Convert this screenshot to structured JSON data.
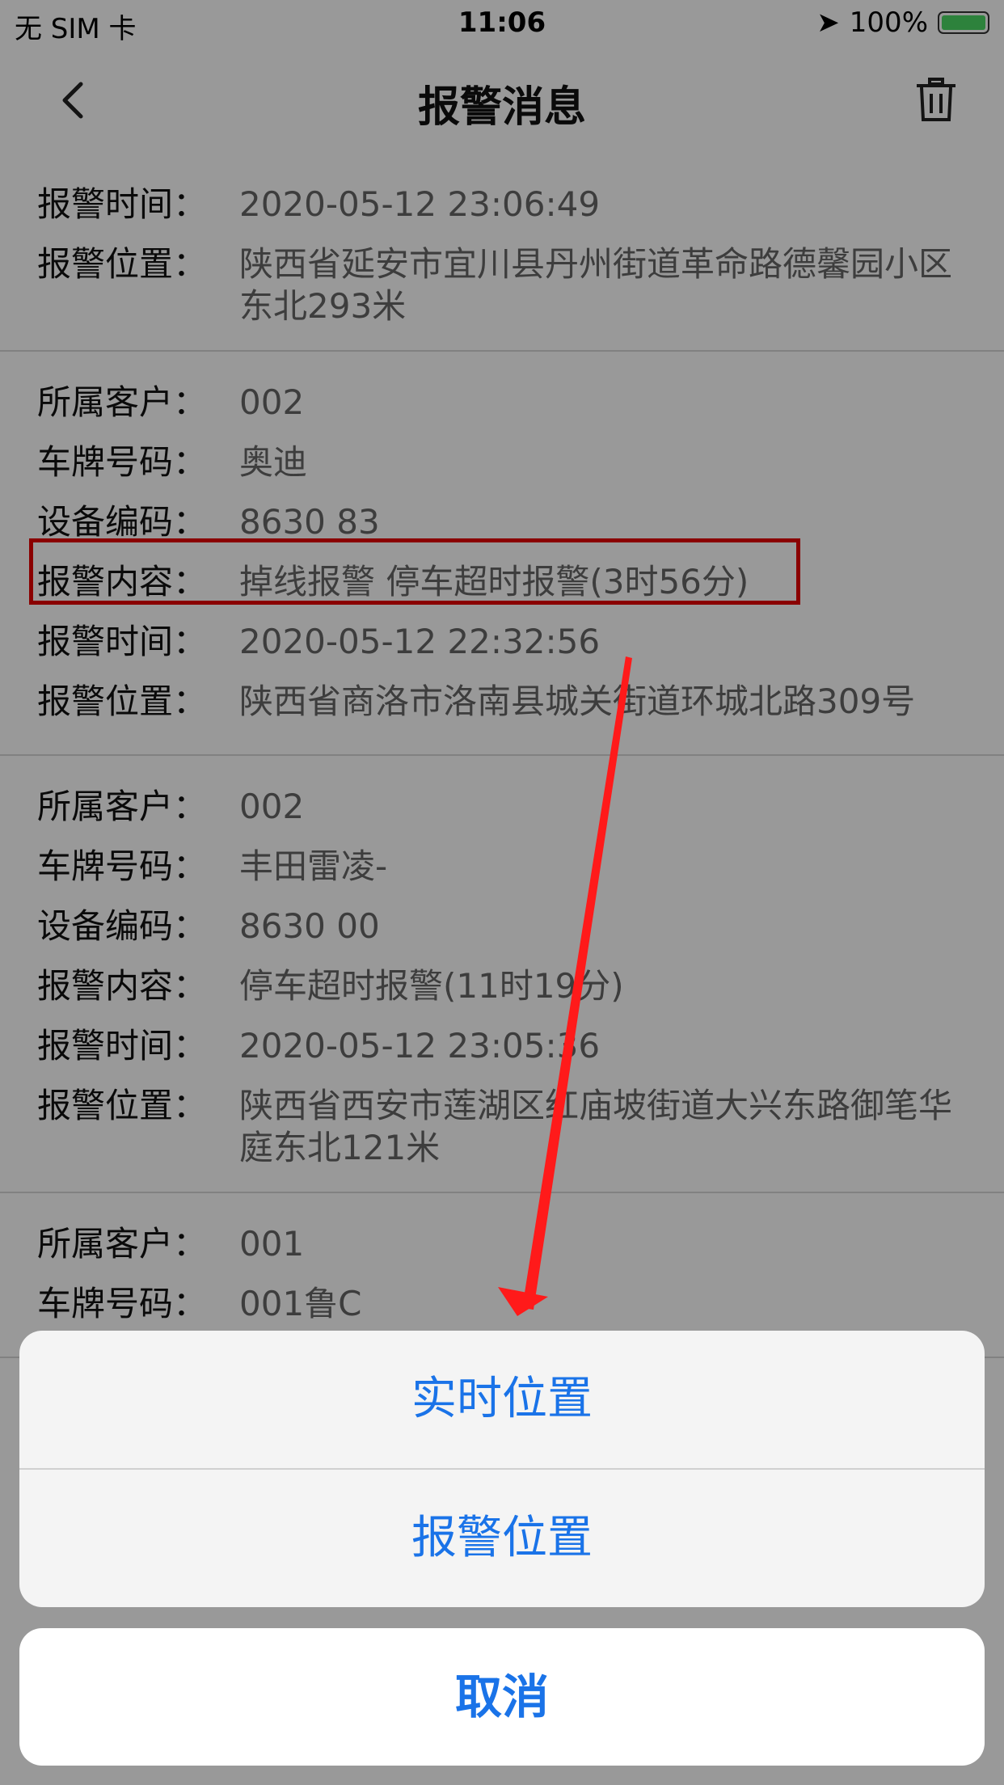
{
  "status_bar": {
    "carrier": "无 SIM 卡",
    "time": "11:06",
    "battery": "100%"
  },
  "header": {
    "title": "报警消息"
  },
  "records": [
    {
      "rows": [
        {
          "label": "报警时间：",
          "value": "2020-05-12 23:06:49"
        },
        {
          "label": "报警位置：",
          "value": "陕西省延安市宜川县丹州街道革命路德馨园小区东北293米"
        }
      ]
    },
    {
      "rows": [
        {
          "label": "所属客户：",
          "value": "002"
        },
        {
          "label": "车牌号码：",
          "value": "奥迪"
        },
        {
          "label": "设备编码：",
          "value": "8630 83"
        },
        {
          "label": "报警内容：",
          "value": " 掉线报警 停车超时报警(3时56分)"
        },
        {
          "label": "报警时间：",
          "value": "2020-05-12 22:32:56"
        },
        {
          "label": "报警位置：",
          "value": "陕西省商洛市洛南县城关街道环城北路309号"
        }
      ]
    },
    {
      "rows": [
        {
          "label": "所属客户：",
          "value": "002"
        },
        {
          "label": "车牌号码：",
          "value": "丰田雷凌-"
        },
        {
          "label": "设备编码：",
          "value": "8630 00"
        },
        {
          "label": "报警内容：",
          "value": " 停车超时报警(11时19分)"
        },
        {
          "label": "报警时间：",
          "value": "2020-05-12 23:05:36"
        },
        {
          "label": "报警位置：",
          "value": "陕西省西安市莲湖区红庙坡街道大兴东路御笔华庭东北121米"
        }
      ]
    },
    {
      "rows": [
        {
          "label": "所属客户：",
          "value": "001"
        },
        {
          "label": "车牌号码：",
          "value": "001鲁C"
        }
      ]
    }
  ],
  "action_sheet": {
    "options": [
      "实时位置",
      "报警位置"
    ],
    "cancel": "取消"
  }
}
